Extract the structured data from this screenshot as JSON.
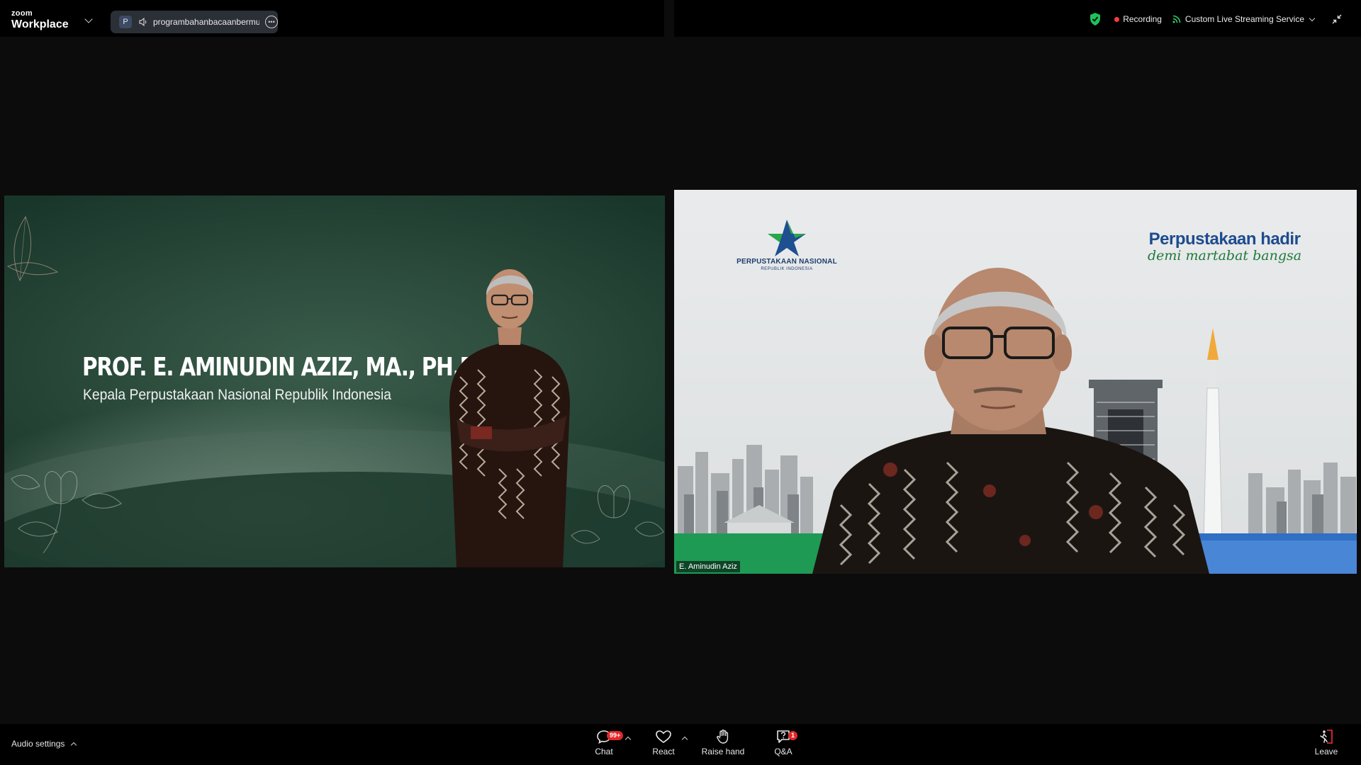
{
  "app": {
    "brand_small": "zoom",
    "brand_main": "Workplace"
  },
  "meeting_pill": {
    "avatar_letter": "P",
    "name": "programbahanbacaanbermutu"
  },
  "status": {
    "recording": "Recording",
    "streaming": "Custom Live Streaming Service"
  },
  "slide": {
    "title": "PROF. E. AMINUDIN AZIZ, MA., PH.D.",
    "subtitle": "Kepala Perpustakaan Nasional Republik Indonesia"
  },
  "camera": {
    "logo_name": "PERPUSTAKAAN NASIONAL",
    "logo_sub": "REPUBLIK INDONESIA",
    "tagline_line1": "Perpustakaan hadir",
    "tagline_line2": "demi martabat bangsa",
    "participant_name": "E. Aminudin Aziz"
  },
  "toolbar": {
    "audio_settings": "Audio settings",
    "chat_label": "Chat",
    "chat_badge": "99+",
    "react_label": "React",
    "raise_hand_label": "Raise hand",
    "qa_label": "Q&A",
    "qa_badge": "1",
    "leave_label": "Leave"
  },
  "colors": {
    "accent_red": "#e02828",
    "shield_green": "#1fc25a",
    "slide_green": "#2a4d3c",
    "tagline_blue": "#1e4b8f",
    "tagline_green": "#1f7a3c"
  }
}
